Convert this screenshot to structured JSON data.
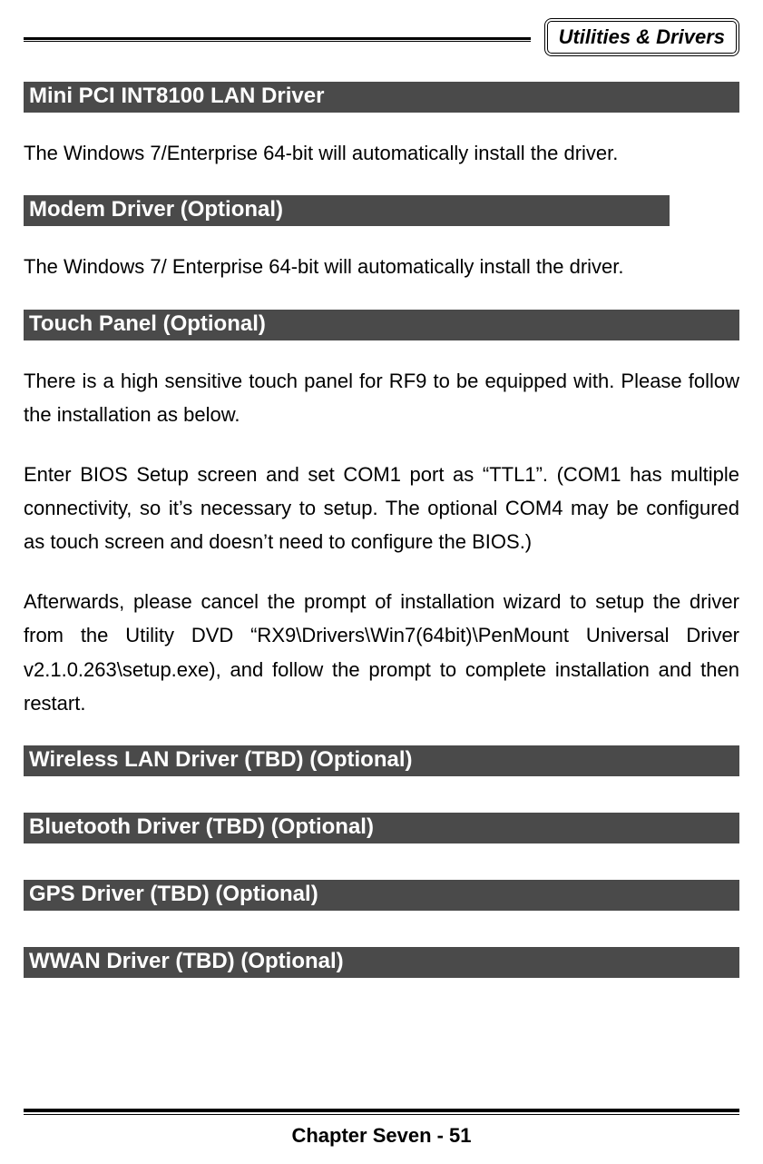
{
  "header": {
    "tab_label": "Utilities & Drivers"
  },
  "sections": {
    "s1": {
      "title": " Mini PCI INT8100 LAN Driver",
      "body1": "The Windows 7/Enterprise 64-bit will automatically install the driver."
    },
    "s2": {
      "title": " Modem Driver (Optional)",
      "body1": "The Windows 7/ Enterprise 64-bit will automatically install the driver."
    },
    "s3": {
      "title": " Touch Panel (Optional)",
      "body1": "There is a high sensitive touch panel for RF9 to be equipped with. Please follow the installation as below.",
      "body2": "Enter BIOS Setup screen and set COM1 port as “TTL1”. (COM1 has multiple connectivity, so it’s necessary to setup. The optional COM4 may be configured as touch screen and doesn’t need to configure the BIOS.)",
      "body3": "Afterwards, please cancel the prompt of installation wizard to setup the driver from the Utility DVD “RX9\\Drivers\\Win7(64bit)\\PenMount Universal Driver v2.1.0.263\\setup.exe), and follow the prompt to complete installation and then restart."
    },
    "s4": {
      "title": " Wireless LAN Driver (TBD) (Optional)"
    },
    "s5": {
      "title": " Bluetooth Driver (TBD) (Optional)"
    },
    "s6": {
      "title": " GPS Driver (TBD) (Optional)"
    },
    "s7": {
      "title": " WWAN Driver (TBD) (Optional)"
    }
  },
  "footer": {
    "text": "Chapter Seven - 51"
  }
}
